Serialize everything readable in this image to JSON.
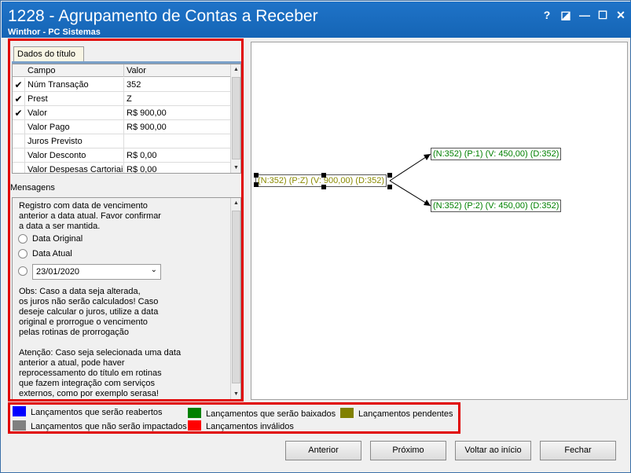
{
  "window": {
    "title": "1228 - Agrupamento de Contas a Receber",
    "subtitle": "Winthor - PC Sistemas",
    "help_glyph": "?",
    "restore_glyph": "◪",
    "minimize_glyph": "—",
    "maximize_glyph": "☐",
    "close_glyph": "✕"
  },
  "panel": {
    "tab_label": "Dados do título",
    "columns": [
      "Campo",
      "Valor"
    ],
    "rows": [
      {
        "checked": true,
        "campo": "Núm Transação",
        "valor": "352"
      },
      {
        "checked": true,
        "campo": "Prest",
        "valor": "Z"
      },
      {
        "checked": true,
        "campo": "Valor",
        "valor": "R$ 900,00"
      },
      {
        "checked": false,
        "campo": "Valor Pago",
        "valor": "R$ 900,00"
      },
      {
        "checked": false,
        "campo": "Juros Previsto",
        "valor": ""
      },
      {
        "checked": false,
        "campo": "Valor Desconto",
        "valor": "R$ 0,00"
      },
      {
        "checked": false,
        "campo": "Valor Despesas Cartoriais",
        "valor": "R$ 0,00"
      }
    ]
  },
  "messages": {
    "label": "Mensagens",
    "intro": [
      "Registro com data de vencimento",
      "anterior a data atual. Favor confirmar",
      "a data a ser mantida."
    ],
    "option_original": "Data Original",
    "option_atual": "Data Atual",
    "date_value": "23/01/2020",
    "obs": [
      "Obs: Caso a data seja alterada,",
      "os juros não serão calculados! Caso",
      "deseje calcular o juros, utilize a data",
      "original e prorrogue o vencimento",
      "pelas rotinas de prorrogação"
    ],
    "attention": [
      "Atenção: Caso seja selecionada uma data",
      "anterior a atual, pode haver",
      "reprocessamento do título em rotinas",
      "que fazem integração com serviços",
      "externos, como por exemplo serasa!"
    ]
  },
  "diagram": {
    "source_node": "(N:352) (P:Z) (V: 900,00) (D:352)",
    "target_nodes": [
      "(N:352) (P:1) (V: 450,00) (D:352)",
      "(N:352) (P:2) (V: 450,00) (D:352)"
    ],
    "source_color": "#8a8a00",
    "target_color": "#008000"
  },
  "legend": [
    {
      "label": "Lançamentos que serão reabertos",
      "color": "#0000ff"
    },
    {
      "label": "Lançamentos que serão baixados",
      "color": "#008000"
    },
    {
      "label": "Lançamentos pendentes",
      "color": "#808000"
    },
    {
      "label": "Lançamentos que não serão impactados",
      "color": "#808080"
    },
    {
      "label": "Lançamentos inválidos",
      "color": "#ff0000"
    }
  ],
  "buttons": {
    "previous": "Anterior",
    "next": "Próximo",
    "back_start": "Voltar ao início",
    "close": "Fechar"
  }
}
